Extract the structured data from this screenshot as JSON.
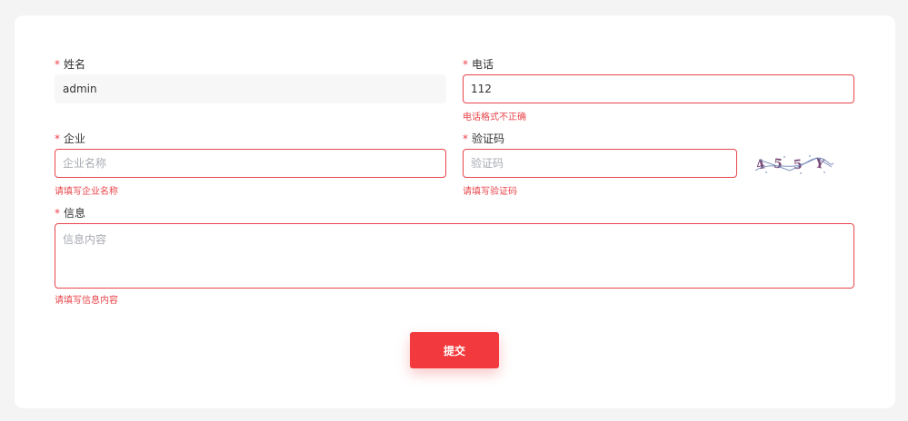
{
  "form": {
    "name": {
      "required_mark": "*",
      "label": "姓名",
      "value": "admin"
    },
    "phone": {
      "required_mark": "*",
      "label": "电话",
      "value": "112",
      "error": "电话格式不正确"
    },
    "company": {
      "required_mark": "*",
      "label": "企业",
      "placeholder": "企业名称",
      "error": "请填写企业名称"
    },
    "captcha": {
      "required_mark": "*",
      "label": "验证码",
      "placeholder": "验证码",
      "error": "请填写验证码"
    },
    "message": {
      "required_mark": "*",
      "label": "信息",
      "placeholder": "信息内容",
      "error": "请填写信息内容"
    },
    "submit_label": "提交"
  },
  "colors": {
    "accent": "#f2393d",
    "error": "#e8454b",
    "required": "#f0434b"
  }
}
